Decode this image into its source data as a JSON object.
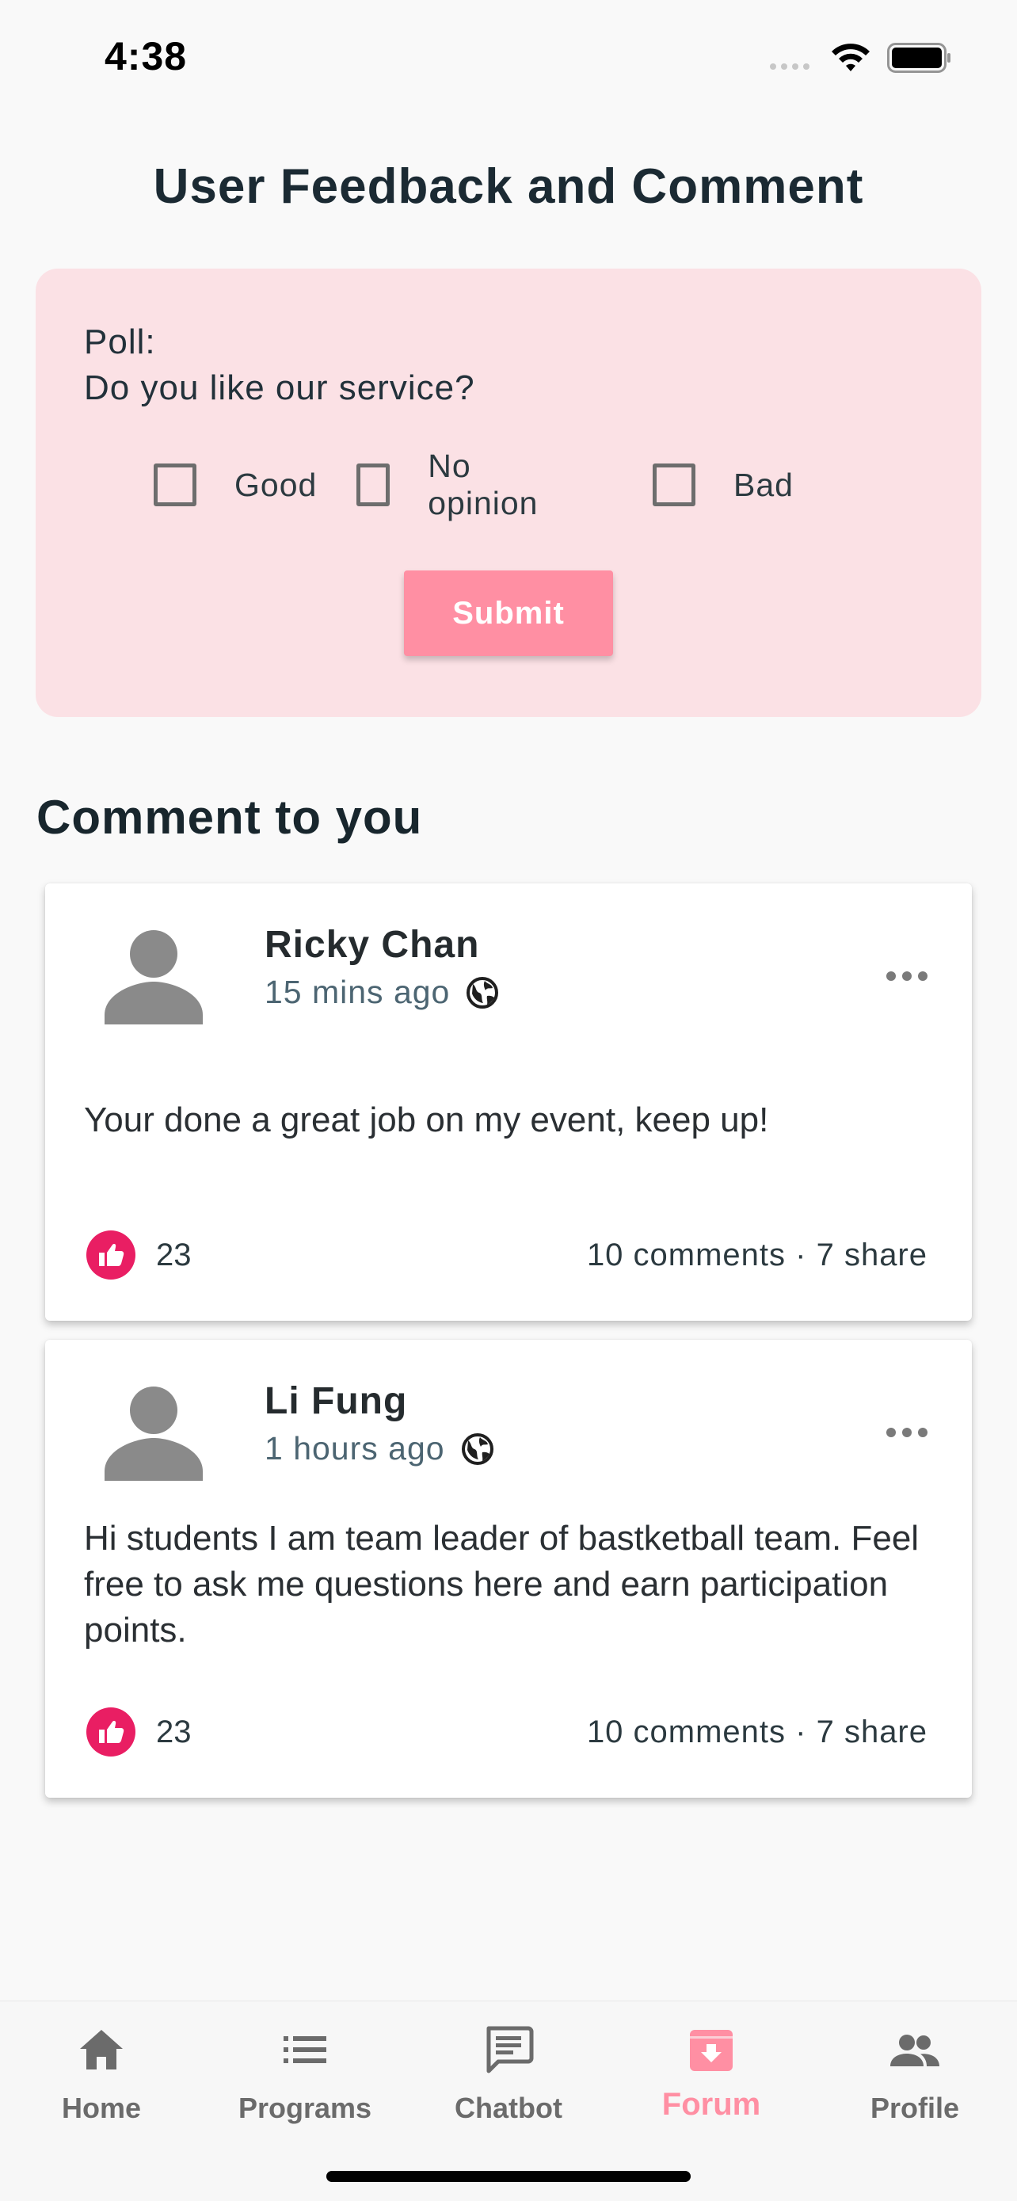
{
  "status_bar": {
    "time": "4:38"
  },
  "page": {
    "title": "User Feedback and Comment"
  },
  "poll": {
    "label": "Poll:",
    "question": "Do you like our service?",
    "options": [
      "Good",
      "No opinion",
      "Bad"
    ],
    "submit_label": "Submit"
  },
  "section": {
    "heading": "Comment to you"
  },
  "comments": [
    {
      "author": "Ricky Chan",
      "time": "15 mins ago",
      "text": "Your done a great job on my event, keep up!",
      "likes": "23",
      "stats": "10 comments · 7 share"
    },
    {
      "author": "Li Fung",
      "time": "1 hours ago",
      "text": "Hi students I am team leader of bastketball team. Feel free to ask me questions here and earn participation points.",
      "likes": "23",
      "stats": "10 comments · 7 share"
    }
  ],
  "nav": [
    {
      "label": "Home",
      "icon": "home-icon"
    },
    {
      "label": "Programs",
      "icon": "list-icon"
    },
    {
      "label": "Chatbot",
      "icon": "chat-icon"
    },
    {
      "label": "Forum",
      "icon": "forum-icon",
      "active": true
    },
    {
      "label": "Profile",
      "icon": "people-icon"
    }
  ],
  "colors": {
    "accent": "#ff8fa3",
    "poll_background": "#fbe1e5",
    "like": "#e91e63",
    "inactive_nav": "#6b6b6b"
  }
}
